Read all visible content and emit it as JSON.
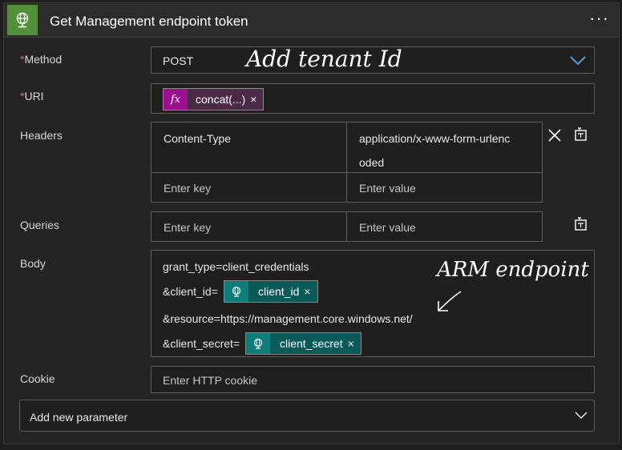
{
  "header": {
    "title": "Get Management endpoint token",
    "more_label": "···",
    "icon": "globe-icon",
    "accent": "#518f3a"
  },
  "method": {
    "label": "Method",
    "required": "*",
    "value": "POST"
  },
  "uri": {
    "label": "URI",
    "required": "*",
    "token_label": "concat(...)",
    "token_icon": "fx",
    "remove": "×"
  },
  "headers": {
    "label": "Headers",
    "row_key": "Content-Type",
    "row_value_line1": "application/x-www-form-urlenc",
    "row_value_line2": "oded",
    "key_placeholder": "Enter key",
    "value_placeholder": "Enter value",
    "delete_icon": "×"
  },
  "queries": {
    "label": "Queries",
    "key_placeholder": "Enter key",
    "value_placeholder": "Enter value"
  },
  "body": {
    "label": "Body",
    "line1": "grant_type=client_credentials",
    "line2_prefix": "&client_id=",
    "token1": "client_id",
    "line3": "&resource=https://management.core.windows.net/",
    "line4_prefix": "&client_secret=",
    "token2": "client_secret",
    "remove": "×"
  },
  "cookie": {
    "label": "Cookie",
    "placeholder": "Enter HTTP cookie"
  },
  "add_param": {
    "label": "Add new parameter"
  },
  "annotations": {
    "tenant": "Add tenant Id",
    "arm": "ARM endpoint"
  }
}
